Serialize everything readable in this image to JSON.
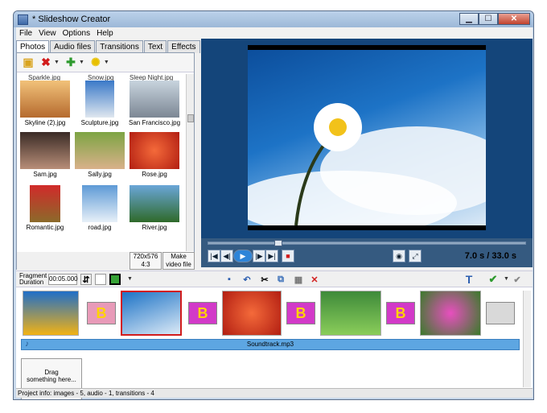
{
  "window": {
    "title": "* Slideshow Creator"
  },
  "menu": [
    "File",
    "View",
    "Options",
    "Help"
  ],
  "tabs": [
    "Photos",
    "Audio files",
    "Transitions",
    "Text",
    "Effects"
  ],
  "thumbnails": {
    "cut_labels": [
      "Sparkle.jpg",
      "Snow.jpg",
      "Sleep Night.jpg"
    ],
    "items": [
      "Skyline (2).jpg",
      "Sculpture.jpg",
      "San Francisco.jpg",
      "Sam.jpg",
      "Sally.jpg",
      "Rose.jpg",
      "Romantic.jpg",
      "road.jpg",
      "River.jpg"
    ]
  },
  "left_bottom": {
    "size_label": "720x576\n4:3",
    "make_video": "Make\nvideo file"
  },
  "player": {
    "time_current": "7.0 s",
    "time_total": "/ 33.0 s"
  },
  "fragment": {
    "label": "Fragment\nDuration",
    "value": "00:05.000"
  },
  "timeline": {
    "audio_label": "Soundtrack.mp3",
    "drag_label": "Drag\nsomething here..."
  },
  "status": "Project info: images - 5, audio - 1, transitions - 4",
  "colors": {
    "preview_bg": "#14457a",
    "selected": "#d21c1c",
    "audio": "#5da6e2"
  }
}
